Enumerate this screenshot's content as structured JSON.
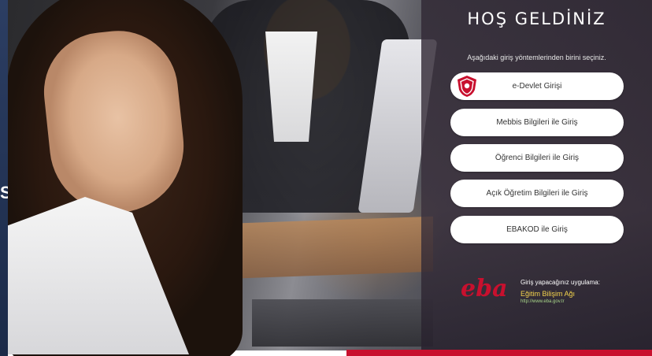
{
  "welcome": {
    "title": "HOŞ GELDİNİZ",
    "subtitle": "Aşağıdaki giriş yöntemlerinden birini seçiniz."
  },
  "login_options": [
    {
      "label": "e-Devlet Girişi",
      "icon": "e-devlet-shield-icon"
    },
    {
      "label": "Mebbis Bilgileri ile Giriş"
    },
    {
      "label": "Öğrenci Bilgileri ile Giriş"
    },
    {
      "label": "Açık Öğretim Bilgileri ile Giriş"
    },
    {
      "label": "EBAKOD ile Giriş"
    }
  ],
  "app_info": {
    "logo_text": "eba",
    "label": "Giriş yapacağınız uygulama:",
    "name": "Eğitim Bilişim Ağı",
    "url": "http://www.eba.gov.tr"
  },
  "left_edge_char": "S",
  "colors": {
    "accent_red": "#c8102e",
    "panel_bg": "#3a303c",
    "app_name": "#f4d44d",
    "app_url": "#a8d68a"
  }
}
